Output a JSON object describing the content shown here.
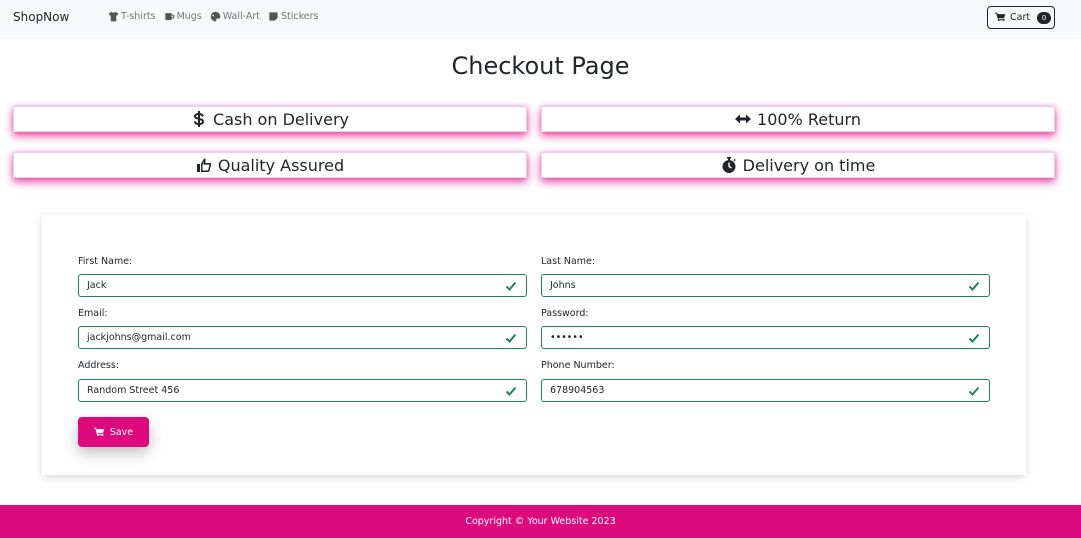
{
  "navbar": {
    "brand": "ShopNow",
    "links": [
      {
        "label": "T-shirts",
        "icon": "tshirt-icon"
      },
      {
        "label": "Mugs",
        "icon": "mug-icon"
      },
      {
        "label": "Wall-Art",
        "icon": "palette-icon"
      },
      {
        "label": "Stickers",
        "icon": "sticker-icon"
      }
    ],
    "cart": {
      "label": "Cart",
      "count": "0",
      "icon": "cart-icon"
    }
  },
  "page": {
    "title": "Checkout Page"
  },
  "features": [
    {
      "label": "Cash on Delivery",
      "icon": "dollar-icon"
    },
    {
      "label": "100% Return",
      "icon": "arrows-horizontal-icon"
    },
    {
      "label": "Quality Assured",
      "icon": "thumbs-up-icon"
    },
    {
      "label": "Delivery on time",
      "icon": "stopwatch-icon"
    }
  ],
  "form": {
    "first_name": {
      "label": "First Name:",
      "value": "Jack"
    },
    "last_name": {
      "label": "Last Name:",
      "value": "Johns"
    },
    "email": {
      "label": "Email:",
      "value": "jackjohns@gmail.com"
    },
    "password": {
      "label": "Password:",
      "value": "••••••"
    },
    "address": {
      "label": "Address:",
      "value": "Random Street 456"
    },
    "phone": {
      "label": "Phone Number:",
      "value": "678904563"
    },
    "save_label": "Save"
  },
  "footer": {
    "text": "Copyright © Your Website 2023"
  },
  "colors": {
    "accent": "#dc0a7c",
    "valid": "#198754",
    "navbar_bg": "#f8f9fa"
  }
}
